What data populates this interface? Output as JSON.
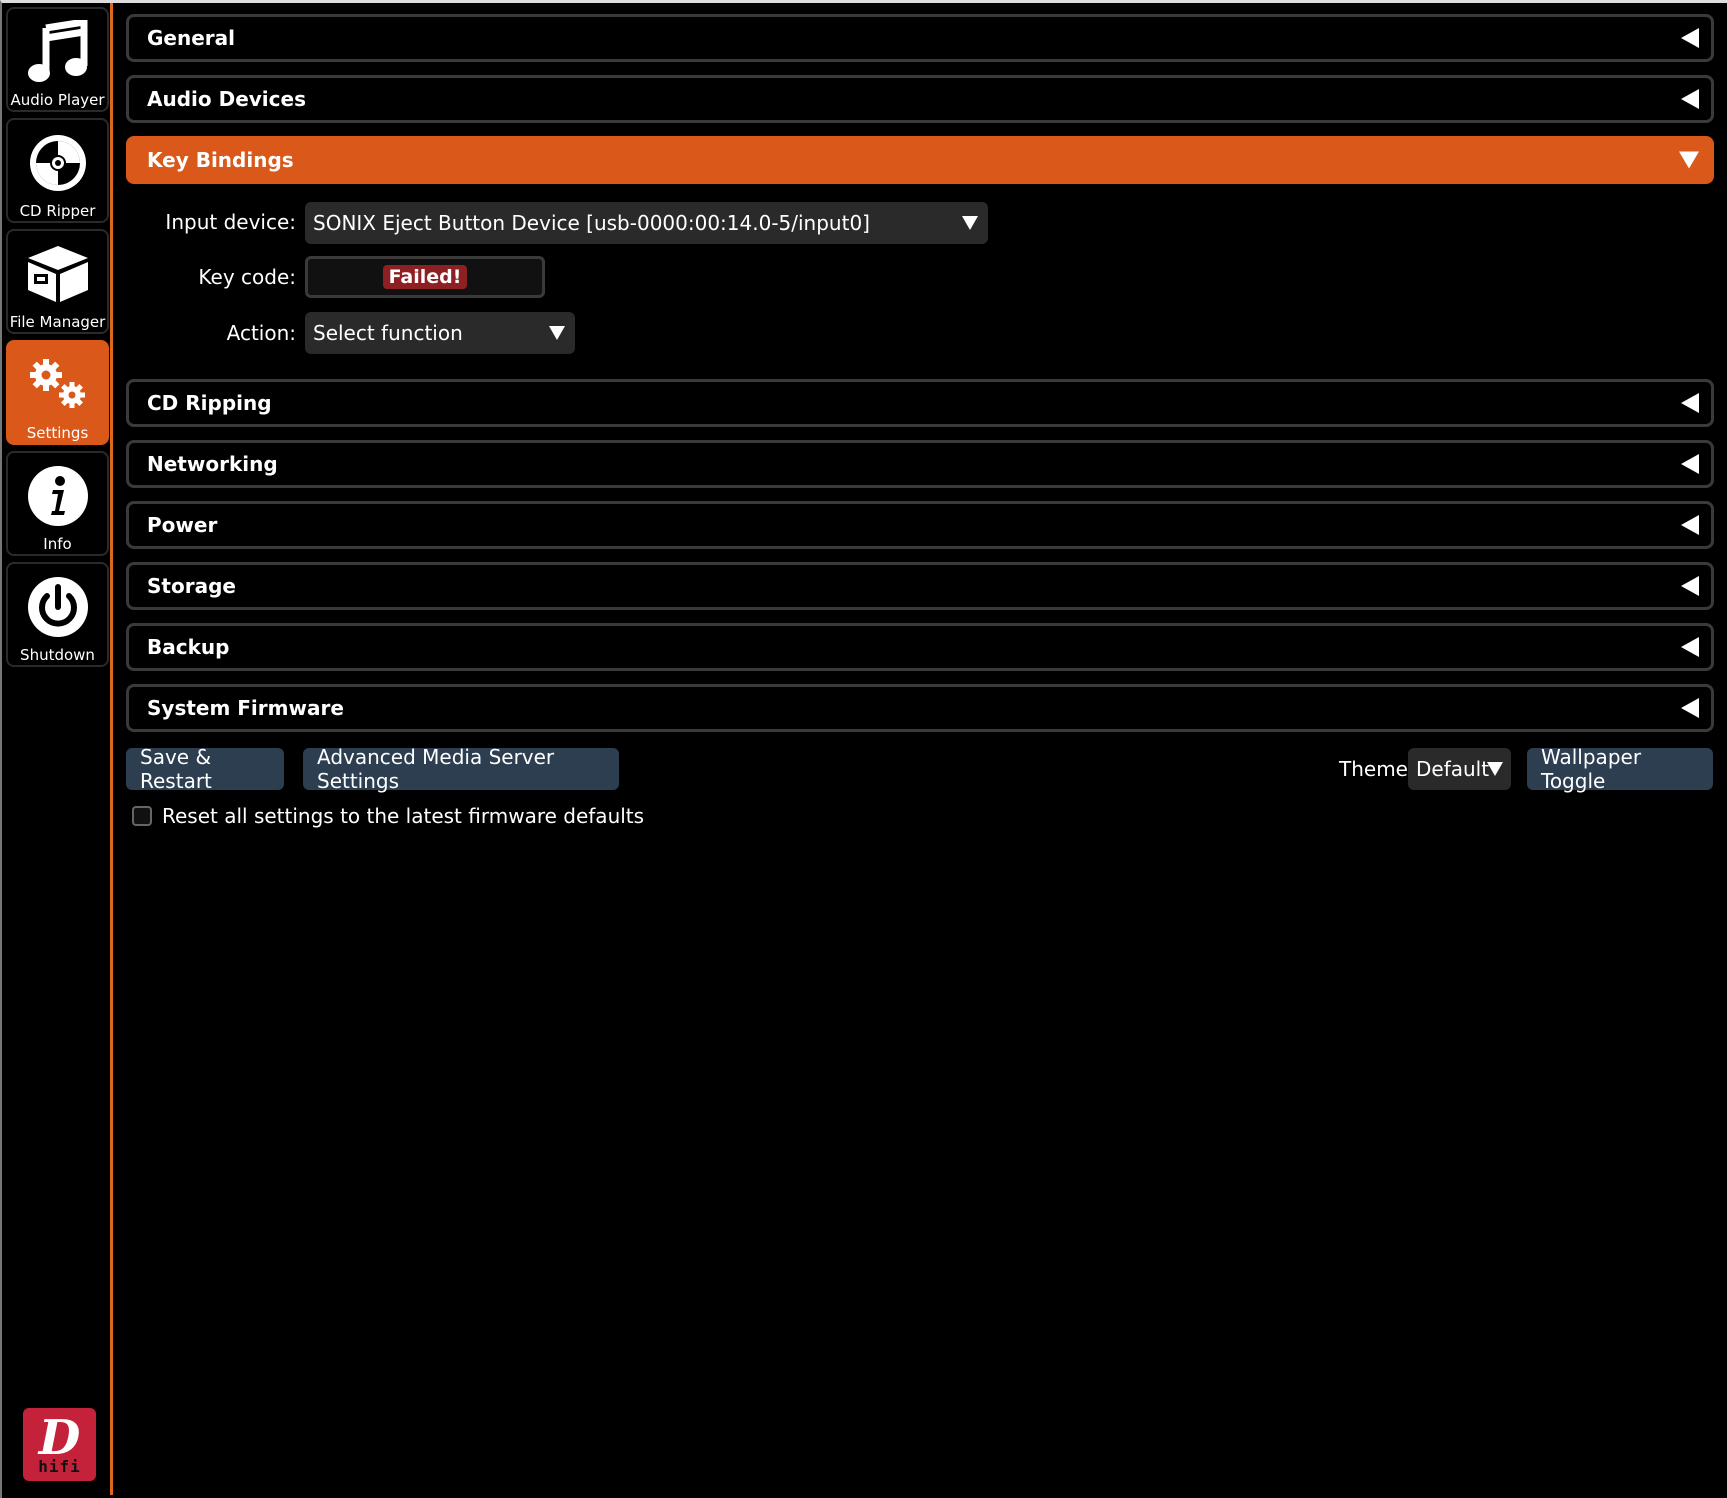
{
  "sidebar": {
    "items": [
      {
        "label": "Audio Player",
        "icon": "music-note-icon",
        "active": false
      },
      {
        "label": "CD Ripper",
        "icon": "disc-icon",
        "active": false
      },
      {
        "label": "File Manager",
        "icon": "box-icon",
        "active": false
      },
      {
        "label": "Settings",
        "icon": "gears-icon",
        "active": true
      },
      {
        "label": "Info",
        "icon": "info-icon",
        "active": false
      },
      {
        "label": "Shutdown",
        "icon": "power-icon",
        "active": false
      }
    ],
    "logo": {
      "mark": "D",
      "text": "hifi",
      "color": "#c4213a"
    }
  },
  "sections": [
    {
      "title": "General",
      "open": false
    },
    {
      "title": "Audio Devices",
      "open": false
    },
    {
      "title": "Key Bindings",
      "open": true
    },
    {
      "title": "CD Ripping",
      "open": false
    },
    {
      "title": "Networking",
      "open": false
    },
    {
      "title": "Power",
      "open": false
    },
    {
      "title": "Storage",
      "open": false
    },
    {
      "title": "Backup",
      "open": false
    },
    {
      "title": "System Firmware",
      "open": false
    }
  ],
  "key_bindings": {
    "input_device_label": "Input device:",
    "input_device_value": "SONIX Eject Button Device [usb-0000:00:14.0-5/input0]",
    "key_code_label": "Key code:",
    "key_code_status": "Failed!",
    "action_label": "Action:",
    "action_value": "Select function"
  },
  "footer": {
    "save_label": "Save & Restart",
    "advanced_label": "Advanced Media Server Settings",
    "theme_label": "Theme:",
    "theme_value": "Default",
    "wallpaper_label": "Wallpaper Toggle",
    "reset_label": "Reset all settings to the latest firmware defaults",
    "reset_checked": false
  },
  "colors": {
    "accent": "#d9581a",
    "button": "#2c3e50",
    "error": "#8e1f22"
  }
}
